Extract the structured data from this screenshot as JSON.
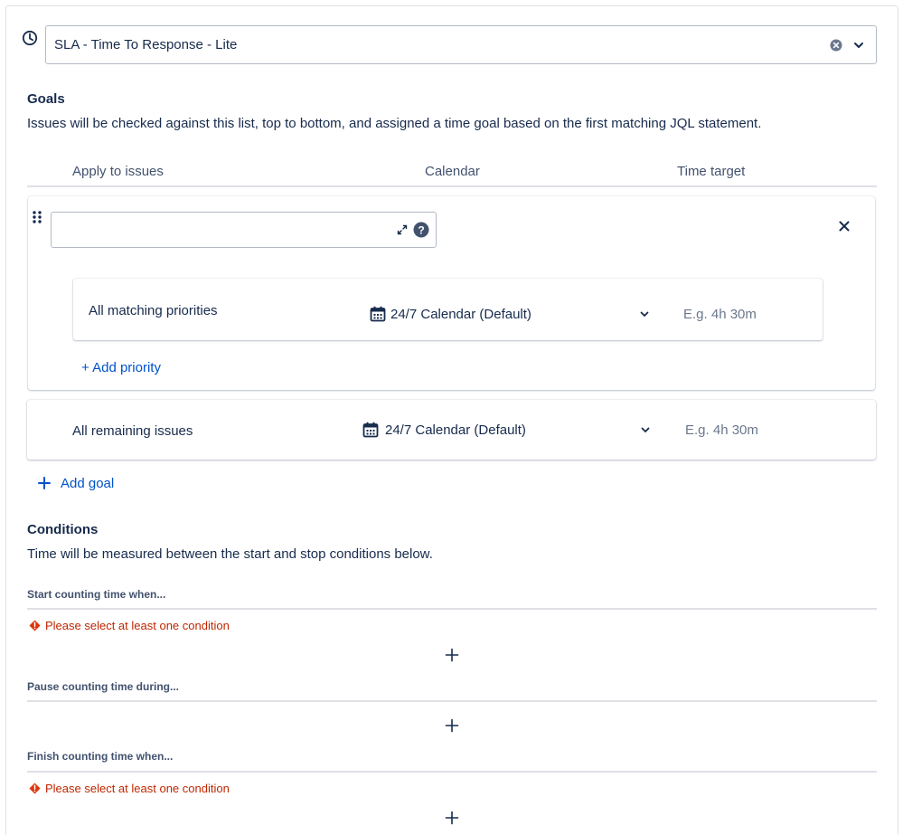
{
  "sla": {
    "value": "SLA - Time To Response - Lite"
  },
  "goals": {
    "title": "Goals",
    "description": "Issues will be checked against this list, top to bottom, and assigned a time goal based on the first matching JQL statement.",
    "columns": {
      "apply": "Apply to issues",
      "calendar": "Calendar",
      "target": "Time target"
    },
    "goal_rows": [
      {
        "jql_value": "",
        "priority_row": {
          "label": "All matching priorities",
          "calendar": "24/7 Calendar (Default)",
          "time_placeholder": "E.g. 4h 30m"
        },
        "add_priority": "+ Add priority"
      }
    ],
    "remaining": {
      "label": "All remaining issues",
      "calendar": "24/7 Calendar (Default)",
      "time_placeholder": "E.g. 4h 30m"
    },
    "add_goal": "Add goal"
  },
  "conditions": {
    "title": "Conditions",
    "description": "Time will be measured between the start and stop conditions below.",
    "start": {
      "label": "Start counting time when...",
      "error": "Please select at least one condition"
    },
    "pause": {
      "label": "Pause counting time during..."
    },
    "finish": {
      "label": "Finish counting time when...",
      "error": "Please select at least one condition"
    }
  },
  "icons": {
    "clock": "clock-icon",
    "clear": "clear-icon",
    "chevron": "chevron-down-icon",
    "drag": "drag-handle-icon",
    "expand": "expand-icon",
    "help": "help-icon",
    "close": "close-icon",
    "calendar": "calendar-icon",
    "plus": "plus-icon",
    "error": "error-icon"
  },
  "colors": {
    "link": "#0052cc",
    "error": "#bf2600",
    "text": "#172b4d",
    "subtle": "#6b778c"
  }
}
